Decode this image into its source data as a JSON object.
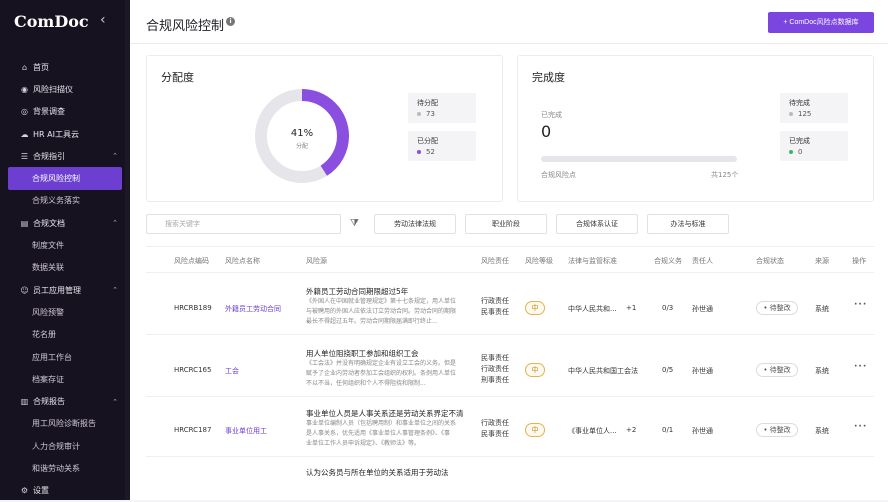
{
  "brand": "ComDoc",
  "nav": [
    {
      "label": "首页",
      "type": "item",
      "icon": "home-icon"
    },
    {
      "label": "风险扫描仪",
      "type": "item",
      "icon": "scanner-icon"
    },
    {
      "label": "背景调查",
      "type": "item",
      "icon": "background-check-icon"
    },
    {
      "label": "HR AI工具云",
      "type": "item",
      "icon": "ai-cloud-icon"
    },
    {
      "label": "合规指引",
      "type": "group",
      "icon": "guide-icon"
    },
    {
      "label": "合规风险控制",
      "type": "sub",
      "active": true
    },
    {
      "label": "合规义务落实",
      "type": "sub"
    },
    {
      "label": "合规文档",
      "type": "group",
      "icon": "document-icon"
    },
    {
      "label": "制度文件",
      "type": "sub"
    },
    {
      "label": "数据关联",
      "type": "sub"
    },
    {
      "label": "员工应用管理",
      "type": "group",
      "icon": "employee-icon"
    },
    {
      "label": "风险预警",
      "type": "sub"
    },
    {
      "label": "花名册",
      "type": "sub"
    },
    {
      "label": "应用工作台",
      "type": "sub"
    },
    {
      "label": "档案存证",
      "type": "sub"
    },
    {
      "label": "合规报告",
      "type": "group",
      "icon": "report-icon"
    },
    {
      "label": "用工风险诊断报告",
      "type": "sub"
    },
    {
      "label": "人力合规审计",
      "type": "sub"
    },
    {
      "label": "和谐劳动关系",
      "type": "sub"
    },
    {
      "label": "设置",
      "type": "group",
      "icon": "settings-icon"
    }
  ],
  "header": {
    "title": "合规风险控制",
    "primary_button": "+ ComDoc风险点数据库"
  },
  "allocation": {
    "title": "分配度",
    "percent": 41,
    "percent_label": "41%",
    "center_sub": "分配",
    "unassigned_label": "待分配",
    "unassigned_value": "73",
    "assigned_label": "已分配",
    "assigned_value": "52",
    "accent": "#8a4fe0",
    "track": "#e6e6ea"
  },
  "completion": {
    "title": "完成度",
    "done_label": "已完成",
    "done_value": "0",
    "bar_left": "合规风险点",
    "bar_right": "共125个",
    "pending_label": "待完成",
    "pending_value": "125",
    "finished_label": "已完成",
    "finished_value": "0",
    "progress": 0
  },
  "toolbar": {
    "search_placeholder": "搜索关键字",
    "chips": [
      "劳动法律法规",
      "职业阶段",
      "合规体系认证",
      "办法与标准"
    ]
  },
  "table": {
    "headers": [
      "风险点编码",
      "风险点名称",
      "风险源",
      "风险责任",
      "风险等级",
      "法律与监管标准",
      "合规义务",
      "责任人",
      "合规状态",
      "来源",
      "操作"
    ],
    "rows": [
      {
        "code": "HRCRB189",
        "name": "外籍员工劳动合同",
        "source_title": "外籍员工劳动合同期限超过5年",
        "source_desc": [
          "《外国人在中国就业管理规定》第十七条规定，用人单位",
          "与被聘用的外国人应依法订立劳动合同。劳动合同的期限",
          "最长不得超过五年。劳动合同期限届满即行终止..."
        ],
        "responsibility": [
          "行政责任",
          "民事责任"
        ],
        "level": "中",
        "law": "中华人民共和...",
        "law_extra": "+1",
        "obligation": "0/3",
        "owner": "孙世通",
        "status": "• 待整改",
        "origin": "系统"
      },
      {
        "code": "HRCRC165",
        "name": "工会",
        "source_title": "用人单位阻挠职工参加和组织工会",
        "source_desc": [
          "《工会法》并没有明确规定企业有设立工会的义务。但是",
          "赋予了企业内劳动者参加工会组织的权利。条例用人单位",
          "不以不当，任何组织和个人不得阻挠和限制..."
        ],
        "responsibility": [
          "民事责任",
          "行政责任",
          "刑事责任"
        ],
        "level": "中",
        "law": "中华人民共和国工会法",
        "law_extra": "",
        "obligation": "0/5",
        "owner": "孙世通",
        "status": "• 待整改",
        "origin": "系统"
      },
      {
        "code": "HRCRC187",
        "name": "事业单位用工",
        "source_title": "事业单位人员是人事关系还是劳动关系界定不清",
        "source_desc": [
          "事业单位编制人员（包括聘用制）和事业单位之间的关系",
          "是人事关系，优先适用《事业单位人事管理条例》、《事",
          "业单位工作人员申诉规定》、《教师法》等。"
        ],
        "responsibility": [
          "行政责任",
          "民事责任"
        ],
        "level": "中",
        "law": "《事业单位人...",
        "law_extra": "+2",
        "obligation": "0/1",
        "owner": "孙世通",
        "status": "• 待整改",
        "origin": "系统"
      }
    ],
    "partial_row_title": "认为公务员与所在单位的关系适用于劳动法"
  }
}
